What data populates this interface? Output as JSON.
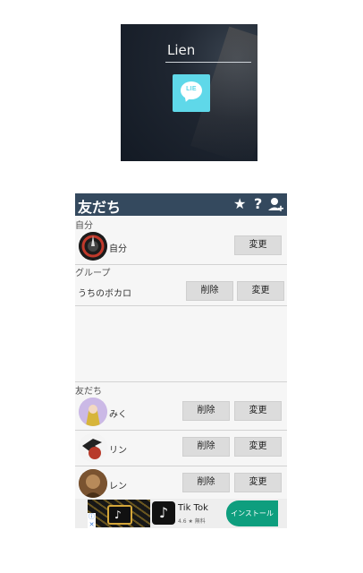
{
  "preview": {
    "title": "Lien",
    "icon_text": "LIE"
  },
  "header": {
    "title": "友だち",
    "star_icon": "★",
    "help_icon": "?",
    "add_user_icon": "👤"
  },
  "sections": {
    "self": "自分",
    "group": "グループ",
    "friends": "友だち"
  },
  "self_row": {
    "name": "自分",
    "change_label": "変更"
  },
  "group_row": {
    "name": "うちのボカロ",
    "delete_label": "削除",
    "change_label": "変更"
  },
  "friends": [
    {
      "name": "みく",
      "delete_label": "削除",
      "change_label": "変更"
    },
    {
      "name": "リン",
      "delete_label": "削除",
      "change_label": "変更"
    },
    {
      "name": "レン",
      "delete_label": "削除",
      "change_label": "変更"
    }
  ],
  "ad": {
    "app_name": "Tik Tok",
    "rating": "4.6 ★ 無料",
    "install_label": "インストール",
    "info": "ⓘ",
    "close": "✕",
    "logo": "♪"
  },
  "colors": {
    "header": "#34495e",
    "preview_icon": "#5fd8e9",
    "install": "#0e9e7e"
  }
}
